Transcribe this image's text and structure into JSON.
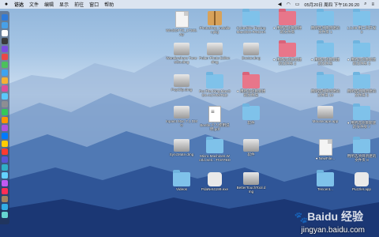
{
  "menubar": {
    "apple_icon": "apple-icon",
    "items": [
      "访达",
      "文件",
      "编辑",
      "显示",
      "前往",
      "窗口",
      "帮助"
    ],
    "status": {
      "clock": "05月20日 周四 下午16:26:20",
      "icons": [
        "volume-icon",
        "wifi-icon",
        "battery-icon",
        "search-icon",
        "menu-icon"
      ]
    }
  },
  "desktop": {
    "icons": [
      {
        "label": "WinSOFTE_17365.zip",
        "kind": "file"
      },
      {
        "label": "Photoshop_installer.pkg",
        "kind": "pkg"
      },
      {
        "label": "CyberBike Racing MacOSX-PAtCHA",
        "kind": "folder"
      },
      {
        "label": "● 用所选项目新建的文件夹",
        "kind": "folder-red"
      },
      {
        "label": "用所选项目新建的文件夹 1",
        "kind": "folder"
      },
      {
        "label": "1.5.98 用工具开发 3",
        "kind": "folder"
      },
      {
        "label": "Wondershare TunesGo.dmg",
        "kind": "disk"
      },
      {
        "label": "Polarr Photo Editor.dmg",
        "kind": "disk"
      },
      {
        "label": "Doctor.dmg",
        "kind": "disk"
      },
      {
        "label": "● 用所选项目新建的文件夹 2",
        "kind": "folder-red"
      },
      {
        "label": "● 用所选项目新建的文件夹",
        "kind": "folder"
      },
      {
        "label": "● 用所选项目新建的文件夹 3",
        "kind": "folder"
      },
      {
        "label": "PopClip.dmg",
        "kind": "disk"
      },
      {
        "label": "For.The.King.MacOSX-ACTIVATED",
        "kind": "folder"
      },
      {
        "label": "● 用所选项目新建的文件夹",
        "kind": "folder-red"
      },
      {
        "label": "用所选项目新建的文件夹 10",
        "kind": "folder"
      },
      {
        "label": "用所选项目新建的文件夹 5",
        "kind": "folder"
      },
      {
        "label": "Inpaint Mac 7.1 DMG",
        "kind": "disk"
      },
      {
        "label": "Beetle 个人使用说明.pdf",
        "kind": "pdf"
      },
      {
        "label": "软件",
        "kind": "folder"
      },
      {
        "label": "Mousecape.app",
        "kind": "disk"
      },
      {
        "label": "● 用所选项目新建的文件夹 7",
        "kind": "folder"
      },
      {
        "label": "SyncMate.dmg",
        "kind": "disk"
      },
      {
        "label": "Micro.Machines.World.Seri...TIVATED",
        "kind": "folder"
      },
      {
        "label": "软件",
        "kind": "disk"
      },
      {
        "label": "● NewFile...",
        "kind": "file"
      },
      {
        "label": "用所选项目新建的文件夹 8",
        "kind": "folder"
      },
      {
        "label": "Videos",
        "kind": "folder"
      },
      {
        "label": "PdaNet4199.exe",
        "kind": "app"
      },
      {
        "label": "BetterTouchTool.dmg",
        "kind": "disk"
      },
      {
        "label": "Tencent...",
        "kind": "folder"
      },
      {
        "label": "Puzzler.app",
        "kind": "app"
      }
    ]
  },
  "watermark": {
    "text": "Baidu 经验",
    "url": "jingyan.baidu.com"
  }
}
